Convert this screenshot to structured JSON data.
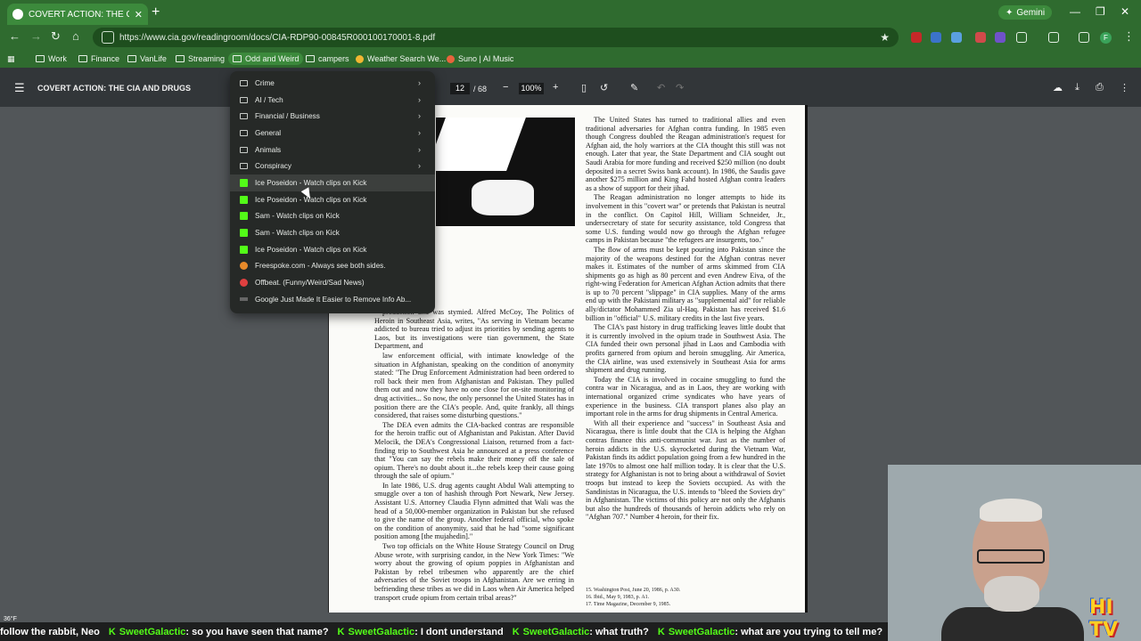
{
  "browser": {
    "tab_title": "COVERT ACTION: THE CIA AND",
    "tab_close": "✕",
    "new_tab": "+",
    "gemini_label": "Gemini",
    "url": "https://www.cia.gov/readingroom/docs/CIA-RDP90-00845R000100170001-8.pdf",
    "bookmarks": [
      {
        "label": "Work"
      },
      {
        "label": "Finance"
      },
      {
        "label": "VanLife"
      },
      {
        "label": "Streaming"
      },
      {
        "label": "Odd and Weird"
      },
      {
        "label": "campers"
      },
      {
        "label": "Weather Search We..."
      },
      {
        "label": "Suno | AI Music"
      }
    ]
  },
  "bookmark_menu": {
    "items": [
      {
        "label": "Crime",
        "type": "folder"
      },
      {
        "label": "AI / Tech",
        "type": "folder"
      },
      {
        "label": "Financial / Business",
        "type": "folder"
      },
      {
        "label": "General",
        "type": "folder"
      },
      {
        "label": "Animals",
        "type": "folder"
      },
      {
        "label": "Conspiracy",
        "type": "folder"
      },
      {
        "label": "Ice Poseidon - Watch clips on Kick",
        "type": "link"
      },
      {
        "label": "Ice Poseidon - Watch clips on Kick",
        "type": "link"
      },
      {
        "label": "Sam - Watch clips on Kick",
        "type": "link"
      },
      {
        "label": "Sam - Watch clips on Kick",
        "type": "link"
      },
      {
        "label": "Ice Poseidon - Watch clips on Kick",
        "type": "link"
      },
      {
        "label": "Freespoke.com - Always see both sides.",
        "type": "link"
      },
      {
        "label": "Offbeat. (Funny/Weird/Sad News)",
        "type": "link"
      },
      {
        "label": "Google Just Made It Easier to Remove Info Ab...",
        "type": "link"
      }
    ]
  },
  "pdf": {
    "title": "COVERT ACTION: THE CIA AND DRUGS",
    "page_current": "12",
    "page_total": "/ 68",
    "zoom": "100%",
    "right_column": [
      "The United States has turned to traditional allies and even traditional adversaries for Afghan contra funding. In 1985 even though Congress doubled the Reagan administration's request for Afghan aid, the holy warriors at the CIA thought this still was not enough. Later that year, the State Department and CIA sought out Saudi Arabia for more funding and received $250 million (no doubt deposited in a secret Swiss bank account). In 1986, the Saudis gave another $275 million and King Fahd hosted Afghan contra leaders as a show of support for their jihad.",
      "The Reagan administration no longer attempts to hide its involvement in this \"covert war\" or pretends that Pakistan is neutral in the conflict. On Capitol Hill, William Schneider, Jr., undersecretary of state for security assistance, told Congress that some U.S. funding would now go through the Afghan refugee camps in Pakistan because \"the refugees are insurgents, too.\"",
      "The flow of arms must be kept pouring into Pakistan since the majority of the weapons destined for the Afghan contras never makes it. Estimates of the number of arms skimmed from CIA shipments go as high as 80 percent and even Andrew Eiva, of the right-wing Federation for American Afghan Action admits that there is up to 70 percent \"slippage\" in CIA supplies. Many of the arms end up with the Pakistani military as \"supplemental aid\" for reliable ally/dictator Mohammed Zia ul-Haq. Pakistan has received $1.6 billion in \"official\" U.S. military credits in the last five years.",
      "The CIA's past history in drug trafficking leaves little doubt that it is currently involved in the opium trade in Southwest Asia. The CIA funded their own personal jihad in Laos and Cambodia with profits garnered from opium and heroin smuggling. Air America, the CIA airline, was used extensively in Southeast Asia for arms shipment and drug running.",
      "Today the CIA is involved in cocaine smuggling to fund the contra war in Nicaragua, and as in Laos, they are working with international organized crime syndicates who have years of experience in the business. CIA transport planes also play an important role in the arms for drug shipments in Central America.",
      "With all their experience and \"success\" in Southeast Asia and Nicaragua, there is little doubt that the CIA is helping the Afghan contras finance this anti-communist war. Just as the number of heroin addicts in the U.S. skyrocketed during the Vietnam War, Pakistan finds its addict population going from a few hundred in the late 1970s to almost one half million today. It is clear that the U.S. strategy for Afghanistan is not to bring about a withdrawal of Soviet troops but instead to keep the Soviets occupied. As with the Sandinistas in Nicaragua, the U.S. intends to \"bleed the Soviets dry\" in Afghanistan. The victims of this policy are not only the Afghanis but also the hundreds of thousands of heroin addicts who rely on \"Afghan 707.\" Number 4 heroin, for their fix."
    ],
    "left_column": [
      "production and was stymied. Alfred McCoy, The Politics of Heroin in Southeast Asia, writes, \"As serving in Vietnam became addicted to bureau tried to adjust its priorities by sending agents to Laos, but its investigations were tian government, the State Department, and",
      "law enforcement official, with intimate knowledge of the situation in Afghanistan, speaking on the condition of anonymity stated: \"The Drug Enforcement Administration had been ordered to roll back their men from Afghanistan and Pakistan. They pulled them out and now they have no one close for on-site monitoring of drug activities... So now, the only personnel the United States has in position there are the CIA's people. And, quite frankly, all things considered, that raises some disturbing questions.\"",
      "The DEA even admits the CIA-backed contras are responsible for the heroin traffic out of Afghanistan and Pakistan. After David Melocik, the DEA's Congressional Liaison, returned from a fact-finding trip to Southwest Asia he announced at a press conference that \"You can say the rebels make their money off the sale of opium. There's no doubt about it...the rebels keep their cause going through the sale of opium.\"",
      "In late 1986, U.S. drug agents caught Abdul Wali attempting to smuggle over a ton of hashish through Port Newark, New Jersey. Assistant U.S. Attorney Claudia Flynn admitted that Wali was the head of a 50,000-member organization in Pakistan but she refused to give the name of the group. Another federal official, who spoke on the condition of anonymity, said that he had \"some significant position among [the mujahedin].\"",
      "Two top officials on the White House Strategy Council on Drug Abuse wrote, with surprising candor, in the New York Times: \"We worry about the growing of opium poppies in Afghanistan and Pakistan by rebel tribesmen who apparently are the chief adversaries of the Soviet troops in Afghanistan. Are we erring in befriending these tribes as we did in Laos when Air America helped transport crude opium from certain tribal areas?\""
    ],
    "footnotes": [
      "15. Washington Post, June 20, 1986, p. A30.",
      "16. Ibid., May 9, 1983, p. A1.",
      "17. Time Magazine, December 9, 1985."
    ]
  },
  "overlay": {
    "weather": "36°F",
    "chat": [
      {
        "user": "",
        "text": "follow the rabbit, Neo"
      },
      {
        "user": "SweetGalactic",
        "text": ": so you have seen that name?"
      },
      {
        "user": "SweetGalactic",
        "text": ": I dont understand"
      },
      {
        "user": "SweetGalactic",
        "text": ": what truth?"
      },
      {
        "user": "SweetGalactic",
        "text": ": what are you trying to tell me?"
      }
    ],
    "logo_text": "HI TV"
  }
}
